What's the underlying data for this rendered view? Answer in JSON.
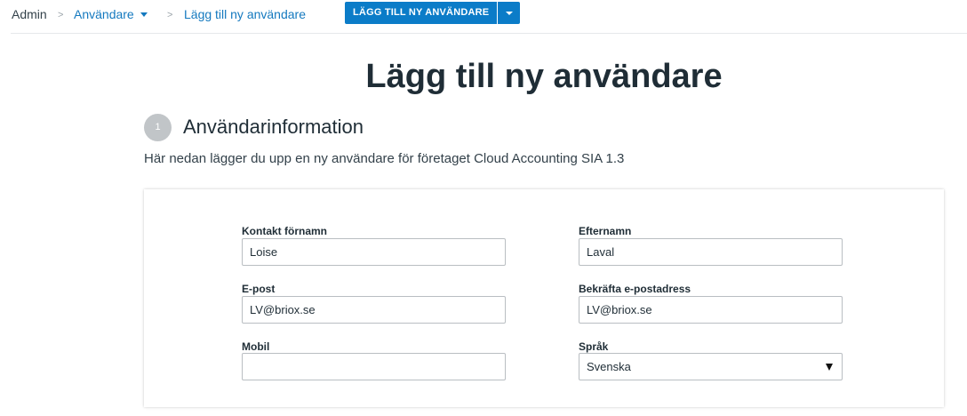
{
  "breadcrumb": {
    "root": "Admin",
    "separator": ">",
    "section": "Användare",
    "current": "Lägg till ny användare"
  },
  "toolbar": {
    "primary_label": "LÄGG TILL NY ANVÄNDARE",
    "dropdown_icon": "chevron-down-icon"
  },
  "page": {
    "title": "Lägg till ny användare"
  },
  "section": {
    "step_number": "1",
    "title": "Användarinformation",
    "description": "Här nedan lägger du upp en ny användare för företaget Cloud Accounting SIA 1.3"
  },
  "form": {
    "first_name": {
      "label": "Kontakt förnamn",
      "value": "Loise"
    },
    "last_name": {
      "label": "Efternamn",
      "value": "Laval"
    },
    "email": {
      "label": "E-post",
      "value": "LV@briox.se"
    },
    "email_confirm": {
      "label": "Bekräfta e-postadress",
      "value": "LV@briox.se"
    },
    "mobile": {
      "label": "Mobil",
      "value": ""
    },
    "language": {
      "label": "Språk",
      "selected": "Svenska"
    }
  },
  "colors": {
    "accent": "#0b7cc8",
    "link": "#1479bf",
    "text": "#1f2d36",
    "badge": "#c1c5c8"
  }
}
